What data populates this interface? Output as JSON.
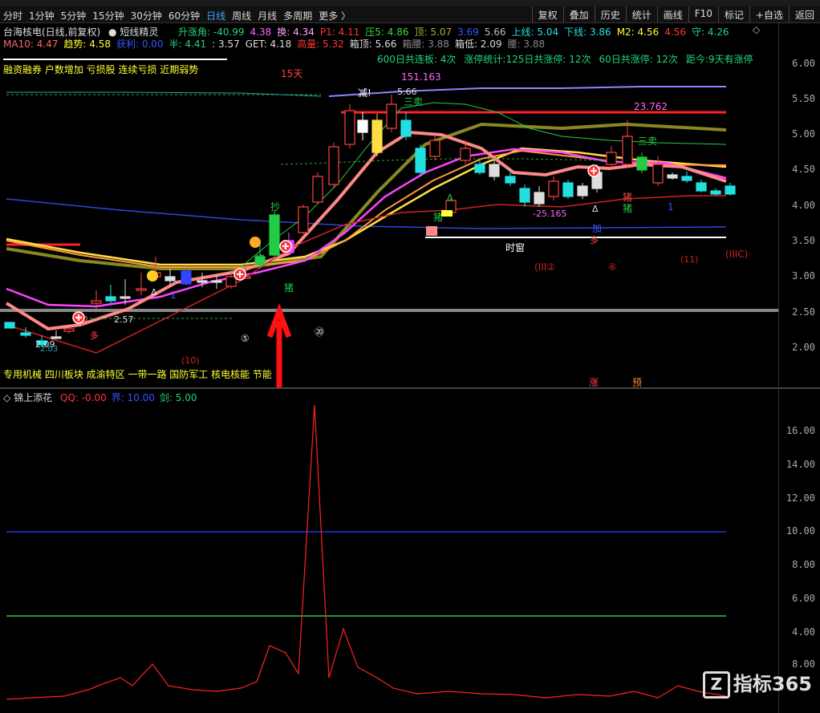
{
  "toolbar": {
    "periods": [
      "分时",
      "1分钟",
      "5分钟",
      "15分钟",
      "30分钟",
      "60分钟",
      "日线",
      "周线",
      "月线",
      "多周期",
      "更多 〉"
    ],
    "active_period": "日线",
    "right_buttons": [
      "复权",
      "叠加",
      "历史",
      "统计",
      "画线",
      "F10",
      "标记",
      "+自选",
      "返回"
    ]
  },
  "main": {
    "title": "台海核电(日线,前复权)",
    "indicator_name": "短线精灵",
    "row1": [
      {
        "text": "升涨角: -40.99",
        "color": "#21d47b"
      },
      {
        "text": "4.38",
        "color": "#ff66ff"
      },
      {
        "text": "换: 4.34",
        "color": "#ffa0ff"
      },
      {
        "text": "P1: 4.11",
        "color": "#ff3333"
      },
      {
        "text": "压5: 4.86",
        "color": "#39d939"
      },
      {
        "text": "顶: 5.07",
        "color": "#aaaa33"
      },
      {
        "text": "3.69",
        "color": "#3355ff"
      },
      {
        "text": "5.66",
        "color": "#bbbbbb"
      },
      {
        "text": "上线: 5.04",
        "color": "#22e0e0"
      },
      {
        "text": "下线: 3.86",
        "color": "#22e0e0"
      },
      {
        "text": "M2: 4.56",
        "color": "#ffff33"
      },
      {
        "text": "4.56",
        "color": "#ff3333"
      },
      {
        "text": "守: 4.26",
        "color": "#21d47b"
      }
    ],
    "row2": [
      {
        "text": "MA10: 4.47",
        "color": "#ff6666"
      },
      {
        "text": "趋势: 4.58",
        "color": "#ffff33"
      },
      {
        "text": "获利: 0.00",
        "color": "#3355ff"
      },
      {
        "text": "半: 4.41",
        "color": "#21d47b"
      },
      {
        "text": ": 3.57",
        "color": "#dddddd"
      },
      {
        "text": "GET: 4.18",
        "color": "#dddddd"
      },
      {
        "text": "高量: 5.32",
        "color": "#ff3333"
      },
      {
        "text": "箱顶: 5.66",
        "color": "#dddddd"
      },
      {
        "text": "箱腰: 3.88",
        "color": "#888888"
      },
      {
        "text": "箱低: 2.09",
        "color": "#dddddd"
      },
      {
        "text": "腰: 3.88",
        "color": "#888888"
      }
    ],
    "row3": [
      {
        "text": "600日共连板: 4次",
        "color": "#21d47b"
      },
      {
        "text": "涨停统计:125日共涨停: 12次",
        "color": "#21d47b"
      },
      {
        "text": "60日共涨停: 12次",
        "color": "#21d47b"
      },
      {
        "text": "距今:9天有涨停",
        "color": "#21d47b"
      }
    ],
    "concept_tags": "融资融券 户数增加 亏损股 连续亏损 近期弱势",
    "bottom_tags": "专用机械 四川板块 成渝特区 一带一路 国防军工 核电核能 节能",
    "y_labels": [
      "6.00",
      "5.50",
      "5.00",
      "4.50",
      "4.00",
      "3.50",
      "3.00",
      "2.50",
      "2.00"
    ],
    "annotations": {
      "days15": "15天",
      "jian": "减!",
      "top_val": "151.163",
      "top_price": "5.66",
      "sanmai": "三卖",
      "val23": "23.762",
      "val_neg": "-25.165",
      "shichuang": "时窗",
      "iiic": "(IIIC)",
      "iii2": "(III②",
      "c6": "⑥",
      "c11": "(11)",
      "c10": "(10)",
      "c5": "⑤",
      "c20": "⑳",
      "lbl209": "2.09",
      "lbl203": "2.03",
      "lbl257": "2.57",
      "duo": "多",
      "zhu": "猪",
      "jia": "加",
      "zhang": "涨",
      "yu": "预",
      "chao": "抄",
      "b1": "1",
      "triangle": "Δ"
    }
  },
  "sub": {
    "title": "锦上添花",
    "legend": [
      {
        "text": "QQ: -0.00",
        "color": "#ff3333"
      },
      {
        "text": "界: 10.00",
        "color": "#3355ff"
      },
      {
        "text": "剑: 5.00",
        "color": "#21d47b"
      }
    ],
    "y_labels": [
      "16.00",
      "14.00",
      "12.00",
      "10.00",
      "8.00",
      "6.00",
      "4.00",
      "8.00"
    ]
  },
  "watermark": {
    "box": "Z",
    "text": "指标365"
  }
}
